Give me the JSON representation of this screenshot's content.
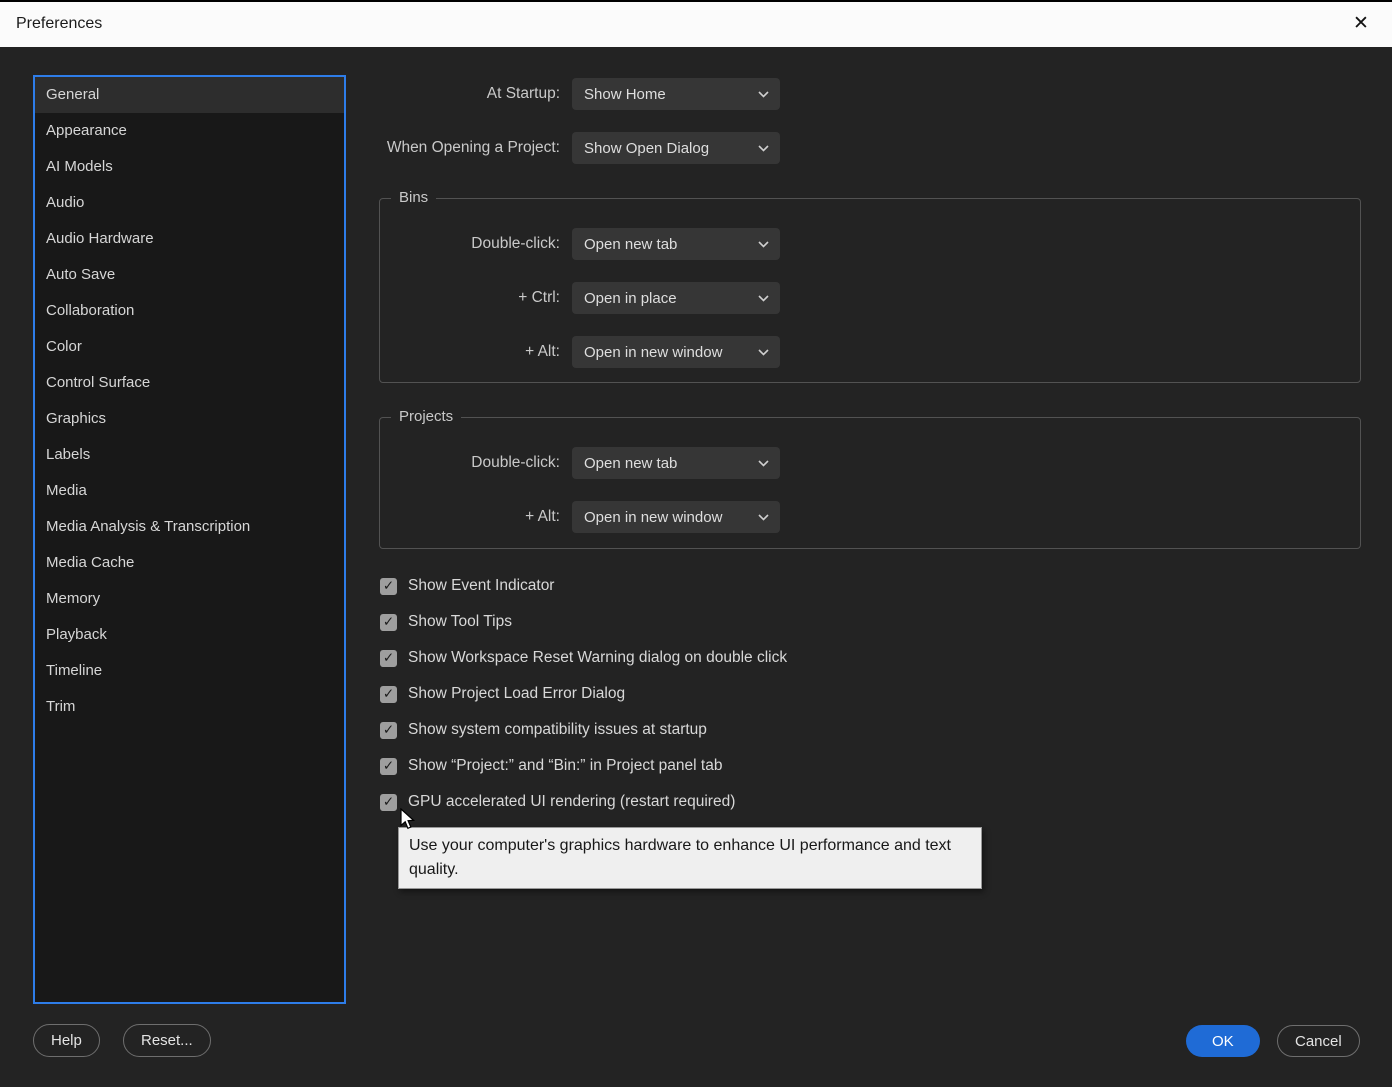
{
  "window": {
    "title": "Preferences",
    "close_glyph": "✕"
  },
  "icons": {
    "check": "✓"
  },
  "colors": {
    "accent": "#1f6bd6",
    "sidebar-border": "#2e7de9"
  },
  "sidebar": {
    "items": [
      {
        "label": "General",
        "selected": true
      },
      {
        "label": "Appearance"
      },
      {
        "label": "AI Models"
      },
      {
        "label": "Audio"
      },
      {
        "label": "Audio Hardware"
      },
      {
        "label": "Auto Save"
      },
      {
        "label": "Collaboration"
      },
      {
        "label": "Color"
      },
      {
        "label": "Control Surface"
      },
      {
        "label": "Graphics"
      },
      {
        "label": "Labels"
      },
      {
        "label": "Media"
      },
      {
        "label": "Media Analysis & Transcription"
      },
      {
        "label": "Media Cache"
      },
      {
        "label": "Memory"
      },
      {
        "label": "Playback"
      },
      {
        "label": "Timeline"
      },
      {
        "label": "Trim"
      }
    ]
  },
  "general": {
    "at_startup": {
      "label": "At Startup:",
      "value": "Show Home"
    },
    "when_opening": {
      "label": "When Opening a Project:",
      "value": "Show Open Dialog"
    },
    "bins": {
      "title": "Bins",
      "rows": [
        {
          "label": "Double-click:",
          "value": "Open new tab"
        },
        {
          "label": "+ Ctrl:",
          "value": "Open in place"
        },
        {
          "label": "+ Alt:",
          "value": "Open in new window"
        }
      ]
    },
    "projects": {
      "title": "Projects",
      "rows": [
        {
          "label": "Double-click:",
          "value": "Open new tab"
        },
        {
          "label": "+ Alt:",
          "value": "Open in new window"
        }
      ]
    },
    "checkboxes": [
      {
        "label": "Show Event Indicator",
        "checked": true
      },
      {
        "label": "Show Tool Tips",
        "checked": true
      },
      {
        "label": "Show Workspace Reset Warning dialog on double click",
        "checked": true
      },
      {
        "label": "Show Project Load Error Dialog",
        "checked": true
      },
      {
        "label": "Show system compatibility issues at startup",
        "checked": true
      },
      {
        "label": "Show “Project:” and “Bin:” in Project panel tab",
        "checked": true
      },
      {
        "label": "GPU accelerated UI rendering (restart required)",
        "checked": true
      }
    ],
    "tooltip": "Use your computer's graphics hardware to enhance UI performance and text quality."
  },
  "footer": {
    "help": "Help",
    "reset": "Reset...",
    "ok": "OK",
    "cancel": "Cancel"
  }
}
